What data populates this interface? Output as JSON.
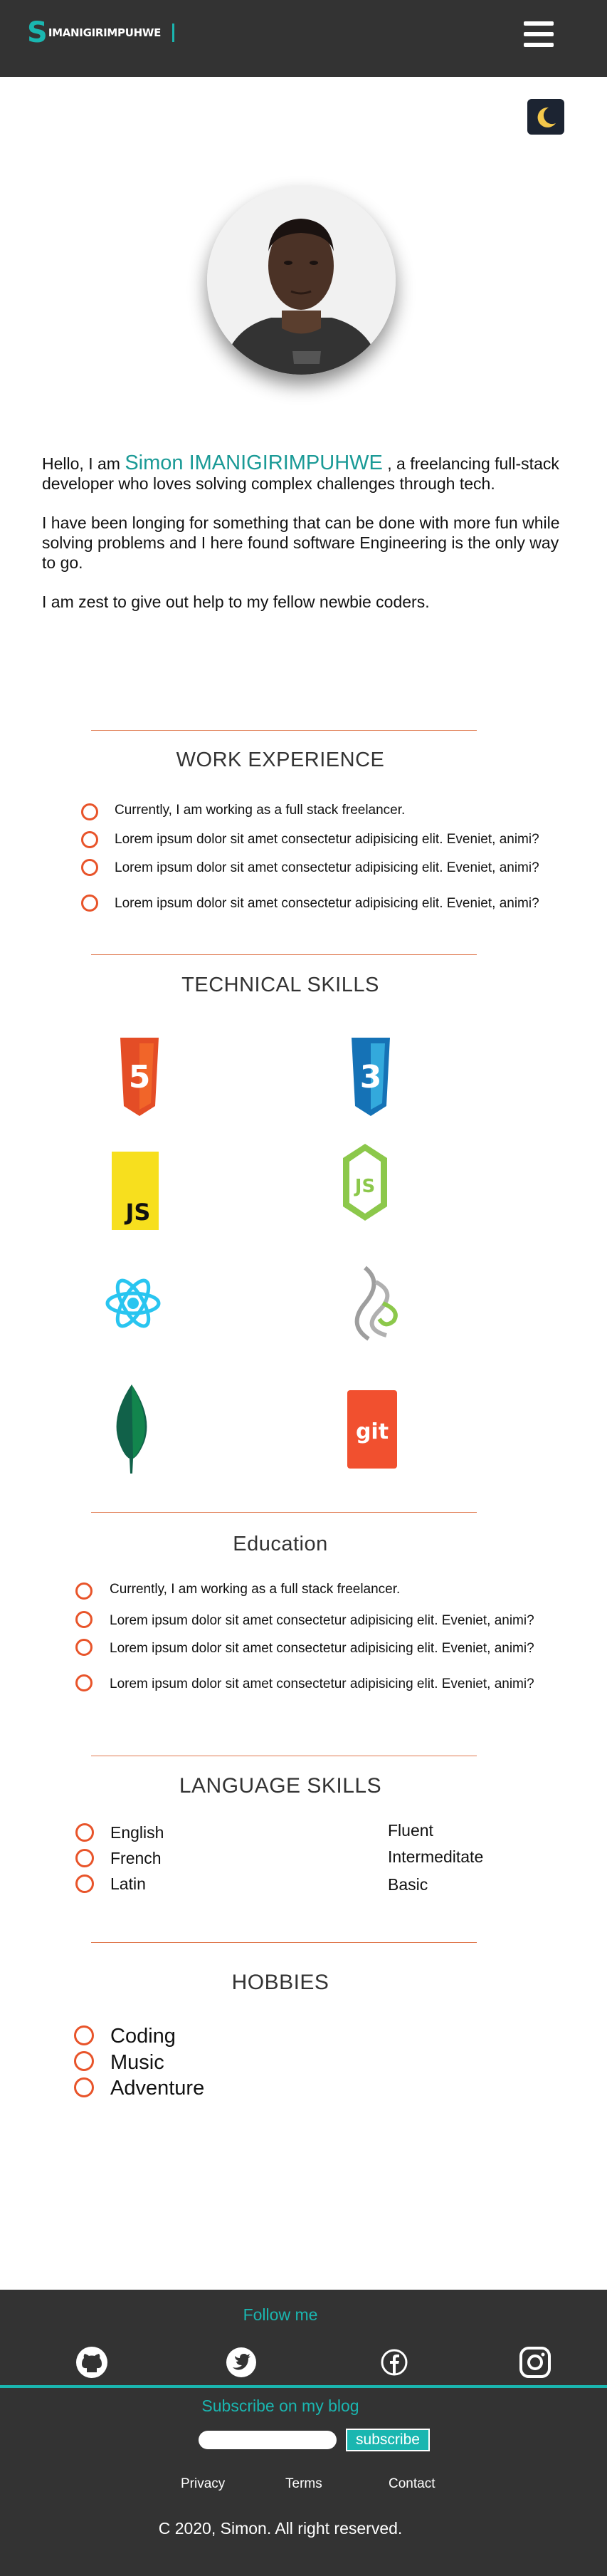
{
  "header": {
    "logo_initial": "S",
    "logo_name": "IMANIGIRIMPUHWE"
  },
  "intro": {
    "greeting": "Hello, I am ",
    "name": "Simon IMANIGIRIMPUHWE",
    "tagline": " , a freelancing full-stack developer who loves solving complex challenges through tech.",
    "paragraph2": "I have been longing for something that can be done with more fun while solving problems and I here found software Engineering is the only way to go.",
    "paragraph3": "I am zest to give out help to my fellow newbie coders."
  },
  "work_experience": {
    "title": "WORK EXPERIENCE",
    "items": [
      "Currently, I am working as a full stack freelancer.",
      "Lorem ipsum dolor sit amet consectetur adipisicing elit. Eveniet, animi?",
      "Lorem ipsum dolor sit amet consectetur adipisicing elit. Eveniet, animi?",
      "Lorem ipsum dolor sit amet consectetur adipisicing elit. Eveniet, animi?"
    ]
  },
  "technical_skills": {
    "title": "TECHNICAL SKILLS",
    "icons": [
      "html5-icon",
      "css3-icon",
      "javascript-icon",
      "nodejs-icon",
      "react-icon",
      "graphql-icon",
      "mongodb-icon",
      "git-icon"
    ],
    "js_label": "JS",
    "node_label": "JS",
    "git_label": "git",
    "html_label": "5",
    "css_label": "3"
  },
  "education": {
    "title": "Education",
    "items": [
      "Currently, I am working as a full stack freelancer.",
      "Lorem ipsum dolor sit amet consectetur adipisicing elit. Eveniet, animi?",
      "Lorem ipsum dolor sit amet consectetur adipisicing elit. Eveniet, animi?",
      "Lorem ipsum dolor sit amet consectetur adipisicing elit. Eveniet, animi?"
    ]
  },
  "language_skills": {
    "title": "LANGUAGE SKILLS",
    "items": [
      {
        "language": "English",
        "level": "Fluent"
      },
      {
        "language": "French",
        "level": "Intermeditate"
      },
      {
        "language": "Latin",
        "level": "Basic"
      }
    ]
  },
  "hobbies": {
    "title": "HOBBIES",
    "items": [
      "Coding",
      "Music",
      "Adventure"
    ]
  },
  "footer": {
    "follow_label": "Follow me",
    "social_icons": [
      "github-icon",
      "twitter-icon",
      "facebook-icon",
      "instagram-icon"
    ],
    "subscribe_label": "Subscribe on my blog",
    "subscribe_input_value": "",
    "subscribe_button": "subscribe",
    "links": [
      "Privacy",
      "Terms",
      "Contact"
    ],
    "copyright": "C 2020, Simon. All right reserved."
  },
  "colors": {
    "accent": "#1ab6b0",
    "dark": "#333333",
    "bullet": "#e8542a",
    "divider": "#e0794f"
  }
}
